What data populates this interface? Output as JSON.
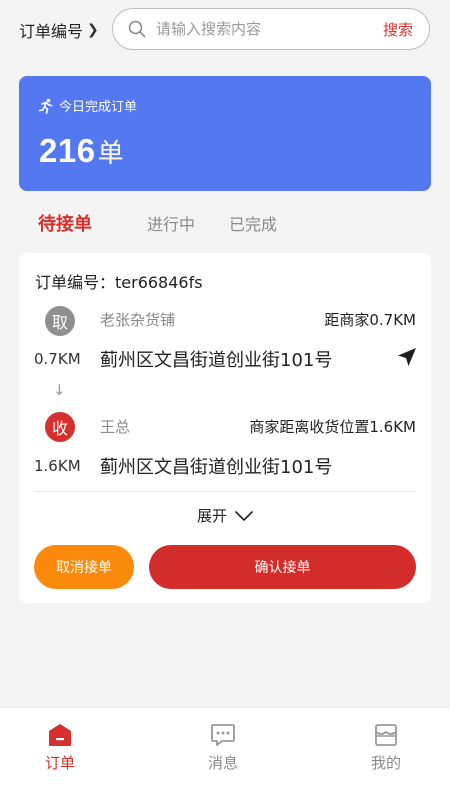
{
  "header": {
    "order_filter_label": "订单编号",
    "search_placeholder": "请输入搜索内容",
    "search_button": "搜索"
  },
  "banner": {
    "caption": "今日完成订单",
    "count": "216",
    "unit": "单",
    "icon": "running-person-icon"
  },
  "tabs": [
    {
      "label": "待接单",
      "active": true
    },
    {
      "label": "进行中",
      "active": false
    },
    {
      "label": "已完成",
      "active": false
    }
  ],
  "order": {
    "order_no": "订单编号：ter66846fs",
    "pickup": {
      "badge": "取",
      "name": "老张杂货铺",
      "distance_label": "距商家0.7KM",
      "km": "0.7KM",
      "address": "蓟州区文昌街道创业街101号"
    },
    "arrow": "↓",
    "receive": {
      "badge": "收",
      "name": "王总",
      "distance_label": "商家距离收货位置1.6KM",
      "km": "1.6KM",
      "address": "蓟州区文昌街道创业街101号"
    },
    "expand_label": "展开",
    "cancel_label": "取消接单",
    "confirm_label": "确认接单"
  },
  "bottom_nav": [
    {
      "label": "订单",
      "icon": "house-icon",
      "active": true
    },
    {
      "label": "消息",
      "icon": "chat-bubble-icon",
      "active": false
    },
    {
      "label": "我的",
      "icon": "profile-icon",
      "active": false
    }
  ],
  "colors": {
    "brand_red": "#d6302e",
    "banner_blue": "#5478f0",
    "cancel_orange": "#fb8a0c"
  }
}
